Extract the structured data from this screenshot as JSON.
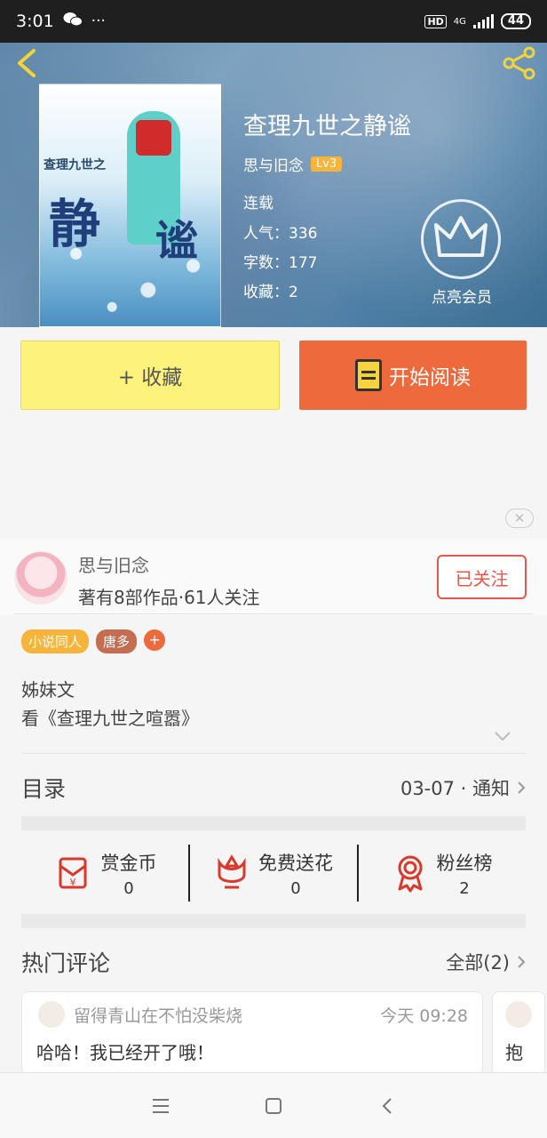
{
  "status_bar": {
    "time": "3:01",
    "hd": "HD",
    "network": "4G",
    "battery": "44",
    "more": "···"
  },
  "book": {
    "title": "查理九世之静谧",
    "author": "思与旧念",
    "level": "Lv3",
    "status": "连载",
    "popularity": "人气：336",
    "word_count": "字数：177",
    "favorites": "收藏：2",
    "cover_text_small": "查理九世之",
    "cover_text_big1": "静",
    "cover_text_big2": "谧"
  },
  "vip": {
    "label": "点亮会员"
  },
  "actions": {
    "collect": "+ 收藏",
    "read": "开始阅读"
  },
  "ad": {
    "close": "✕"
  },
  "author_card": {
    "name": "思与旧念",
    "stats": "著有8部作品·61人关注",
    "follow": "已关注"
  },
  "tags": [
    "小说同人",
    "唐多"
  ],
  "tag_add": "+",
  "intro": {
    "line1": "姊妹文",
    "line2": "看《查理九世之喧嚣》"
  },
  "catalog": {
    "title": "目录",
    "latest": "03-07 · 通知"
  },
  "stats": [
    {
      "label": "赏金币",
      "value": "0",
      "icon": "red-envelope-icon"
    },
    {
      "label": "免费送花",
      "value": "0",
      "icon": "flower-icon"
    },
    {
      "label": "粉丝榜",
      "value": "2",
      "icon": "medal-icon"
    }
  ],
  "comments": {
    "title": "热门评论",
    "all": "全部(2)",
    "items": [
      {
        "user": "留得青山在不怕没柴烧",
        "time": "今天 09:28",
        "text": "哈哈！我已经开了哦！"
      },
      {
        "text": "抱"
      }
    ]
  },
  "colors": {
    "accent_orange": "#ee6a3c",
    "accent_yellow": "#fdf27b",
    "follow_red": "#e7574a",
    "badge_gold": "#f6b43a"
  }
}
